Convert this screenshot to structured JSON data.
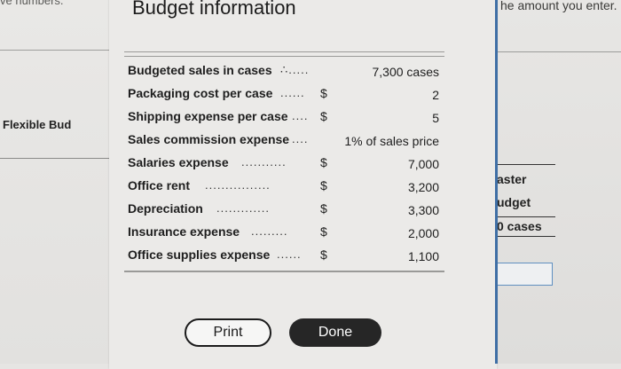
{
  "background": {
    "left": {
      "top_fragment": "ve numbers.",
      "side_label": "Flexible Bud"
    },
    "right": {
      "top_fragment": "he amount you enter.",
      "col_lines": [
        "aster",
        "udget",
        "0 cases"
      ]
    }
  },
  "modal": {
    "title": "Budget information",
    "rows": [
      {
        "label": "Budgeted sales in cases",
        "dots": "∴.....",
        "currency": "",
        "value": "7,300 cases"
      },
      {
        "label": "Packaging cost per case",
        "dots": "......",
        "currency": "$",
        "value": "2"
      },
      {
        "label": "Shipping expense per case",
        "dots": "....",
        "currency": "$",
        "value": "5"
      },
      {
        "label": "Sales commission expense",
        "dots": "....",
        "currency": "",
        "value": "1% of sales price"
      },
      {
        "label": "Salaries expense",
        "dots": "...........",
        "currency": "$",
        "value": "7,000"
      },
      {
        "label": "Office rent",
        "dots": "................",
        "currency": "$",
        "value": "3,200"
      },
      {
        "label": "Depreciation",
        "dots": ".............",
        "currency": "$",
        "value": "3,300"
      },
      {
        "label": "Insurance expense",
        "dots": ".........",
        "currency": "$",
        "value": "2,000"
      },
      {
        "label": "Office supplies expense",
        "dots": "......",
        "currency": "$",
        "value": "1,100"
      }
    ],
    "buttons": {
      "print": "Print",
      "done": "Done"
    }
  },
  "colors": {
    "accent_border": "#3f6fa5",
    "done_bg": "#262626"
  }
}
